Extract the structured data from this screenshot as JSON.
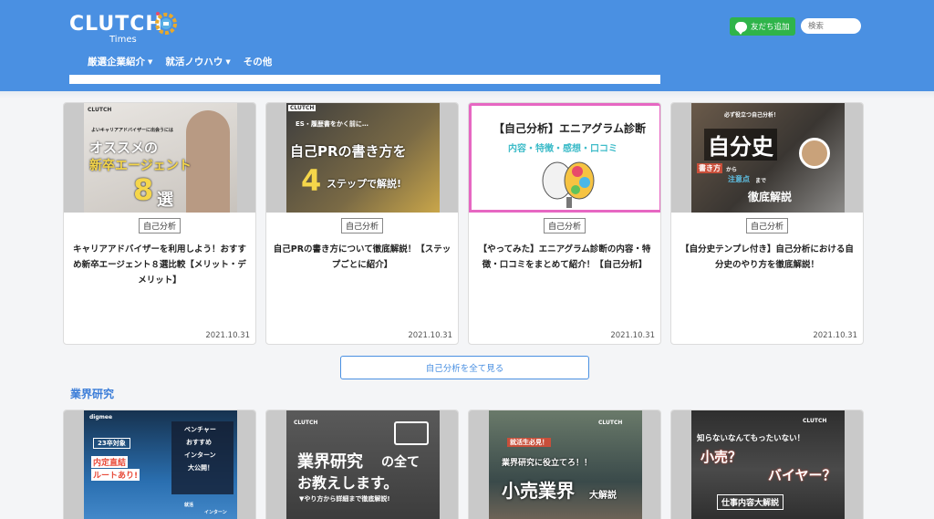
{
  "header": {
    "logo_text": "CLUTCH",
    "logo_sub": "Times",
    "nav": [
      {
        "label": "厳選企業紹介",
        "has_caret": true
      },
      {
        "label": "就活ノウハウ",
        "has_caret": true
      },
      {
        "label": "その他",
        "has_caret": false
      }
    ],
    "line_button": "友だち追加",
    "search_placeholder": "検索"
  },
  "cards": [
    {
      "category": "自己分析",
      "title": "キャリアアドバイザーを利用しよう！おすすめ新卒エージェント８選比較【メリット・デメリット】",
      "date": "2021.10.31",
      "thumb": {
        "top_text": "よいキャリアアドバイザーに出会うには",
        "line1": "オススメの",
        "line2": "新卒エージェント",
        "big": "8",
        "big2": "選",
        "brand": "CLUTCH"
      }
    },
    {
      "category": "自己分析",
      "title": "自己PRの書き方について徹底解説！【ステップごとに紹介】",
      "date": "2021.10.31",
      "thumb": {
        "top_text": "ES・履歴書をかく前に…",
        "line1": "自己PRの書き方を",
        "big": "4",
        "line2": "ステップで解説!",
        "brand": "CLUTCH"
      }
    },
    {
      "category": "自己分析",
      "title": "【やってみた】エニアグラム診断の内容・特徴・口コミをまとめて紹介！【自己分析】",
      "date": "2021.10.31",
      "thumb": {
        "line1": "【自己分析】エニアグラム診断",
        "line2": "内容・特徴・感想・口コミ"
      }
    },
    {
      "category": "自己分析",
      "title": "【自分史テンプレ付き】自己分析における自分史のやり方を徹底解説！",
      "date": "2021.10.31",
      "thumb": {
        "top_text": "必ず役立つ自己分析！",
        "line1": "自分史",
        "line2": "書き方",
        "line3": "から",
        "line4": "注意点",
        "line5": "まで",
        "line6": "徹底解説"
      }
    }
  ],
  "more_button": "自己分析を全て見る",
  "section_title": "業界研究",
  "cards2": [
    {
      "thumb": {
        "brand": "digmee",
        "badge": "23卒対象",
        "line1": "内定直結",
        "line2": "ルートあり!",
        "r1": "ベンチャー",
        "r2": "おすすめ",
        "r3": "インターン",
        "r4": "大公開！",
        "b1": "就活",
        "b2": "インターン"
      }
    },
    {
      "thumb": {
        "brand": "CLUTCH",
        "line1": "業界研究",
        "line1b": "の全て",
        "line2": "お教えします。",
        "line3": "▼やり方から詳細まで徹底解説!"
      }
    },
    {
      "thumb": {
        "brand": "CLUTCH",
        "badge": "就活生必見！",
        "line1": "業界研究に役立てろ！！",
        "line2": "小売業界",
        "line3": "大解説"
      }
    },
    {
      "thumb": {
        "brand": "CLUTCH",
        "line1": "知らないなんてもったいない！",
        "line2": "小売？",
        "line3": "バイヤー？",
        "line4": "仕事内容大解説"
      }
    }
  ]
}
